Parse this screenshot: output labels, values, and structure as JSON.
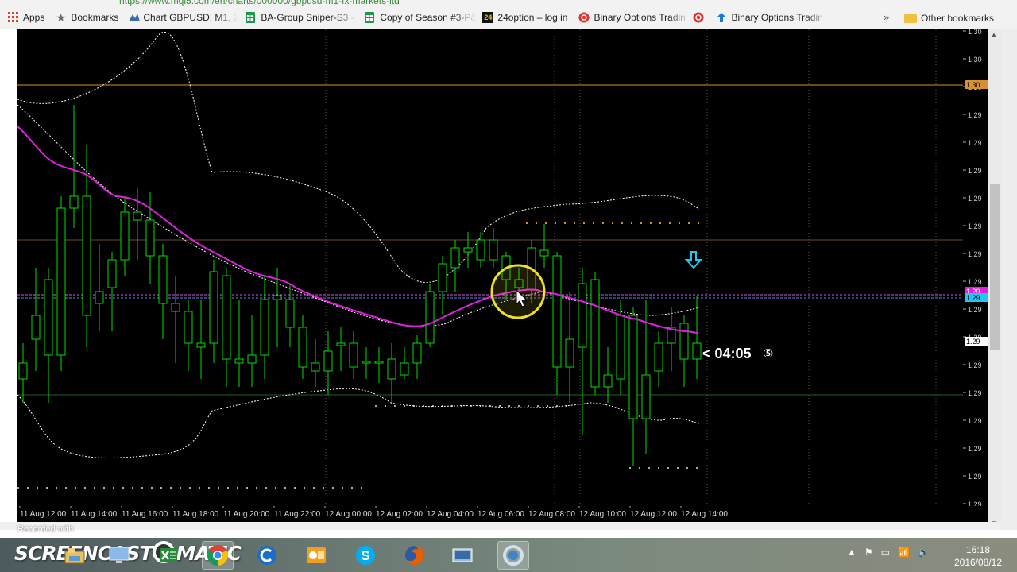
{
  "browser": {
    "url_fragment": "https://www.mql5.com/en/charts/000000/gbpusd-m1-fx-markets-ltd",
    "bookmarks": [
      {
        "label": "Apps",
        "icon": "apps-grid-icon"
      },
      {
        "label": "Bookmarks",
        "icon": "star-icon"
      },
      {
        "label": "Chart GBPUSD, M1, 20",
        "icon": "mql5-icon"
      },
      {
        "label": "BA-Group Sniper-S3 -",
        "icon": "sheets-icon"
      },
      {
        "label": "Copy of Season #3-P&",
        "icon": "sheets-icon"
      },
      {
        "label": "24option – log in",
        "icon": "24option-icon"
      },
      {
        "label": "Binary Options Tradin",
        "icon": "binary-options-icon"
      },
      {
        "label": "",
        "icon": "binary-options-icon"
      },
      {
        "label": "Binary Options Tradin",
        "icon": "arrow-up-icon"
      }
    ],
    "more_label": "»",
    "other_bookmarks": "Other bookmarks"
  },
  "chart": {
    "countdown": "< 04:05",
    "countdown_badge": "⑤",
    "time_labels": [
      "11 Aug 12:00",
      "11 Aug 14:00",
      "11 Aug 16:00",
      "11 Aug 18:00",
      "11 Aug 20:00",
      "11 Aug 22:00",
      "12 Aug 00:00",
      "12 Aug 02:00",
      "12 Aug 04:00",
      "12 Aug 06:00",
      "12 Aug 08:00",
      "12 Aug 10:00",
      "12 Aug 12:00",
      "12 Aug 14:00"
    ],
    "price_labels": [
      "1.30",
      "1.30",
      "1.30",
      "1.29",
      "1.29",
      "1.29",
      "1.29",
      "1.29",
      "1.29",
      "1.29",
      "1.29",
      "1.29",
      "1.29",
      "1.29",
      "1.29",
      "1.29",
      "1.29",
      "1.29"
    ],
    "price_tags": [
      "1.30",
      "1.29",
      "1.29",
      "1.29"
    ],
    "colors": {
      "bull": "#ffffff",
      "bear": "#000000",
      "wick": "#00dd00",
      "ma": "#e020e0",
      "band": "#ffffff",
      "hline": "#d89030",
      "signal": "#20c8f0",
      "cursor": "#f0e020"
    }
  },
  "overlay": {
    "recorded": "Recorded with"
  },
  "taskbar": {
    "brand": "SCREENCAST",
    "brand_o": "O",
    "brand_suffix": "MATIC",
    "time": "16:18",
    "date": "2016/08/12"
  }
}
